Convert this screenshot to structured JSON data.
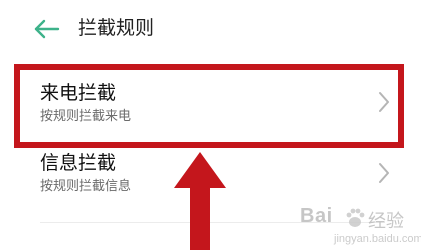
{
  "header": {
    "title": "拦截规则",
    "back_icon": "arrow-left-icon",
    "accent_color": "#3db28a"
  },
  "items": [
    {
      "title": "来电拦截",
      "subtitle": "按规则拦截来电",
      "icon": "chevron-right-icon"
    },
    {
      "title": "信息拦截",
      "subtitle": "按规则拦截信息",
      "icon": "chevron-right-icon"
    }
  ],
  "annotation": {
    "highlight_color": "#c4161c",
    "arrow_icon": "arrow-up-icon"
  },
  "watermark": {
    "brand_left": "Bai",
    "brand_right": "经验",
    "url": "jingyan.baidu.com"
  }
}
